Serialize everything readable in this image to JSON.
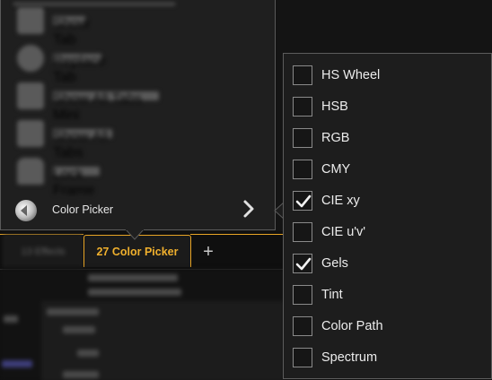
{
  "tabs": {
    "inactive_label": "13 Effects",
    "active_label": "27 Color Picker",
    "add_label": "+"
  },
  "toolbox": {
    "blurred_items": [
      "Show Tab",
      "Replace Tab",
      "Show All Tabs Mini",
      "Show All Tabs",
      "Lock Frame"
    ],
    "color_picker_label": "Color Picker"
  },
  "menu": {
    "items": [
      {
        "label": "HS Wheel",
        "checked": false
      },
      {
        "label": "HSB",
        "checked": false
      },
      {
        "label": "RGB",
        "checked": false
      },
      {
        "label": "CMY",
        "checked": false
      },
      {
        "label": "CIE xy",
        "checked": true
      },
      {
        "label": "CIE u'v'",
        "checked": false
      },
      {
        "label": "Gels",
        "checked": true
      },
      {
        "label": "Tint",
        "checked": false
      },
      {
        "label": "Color Path",
        "checked": false
      },
      {
        "label": "Spectrum",
        "checked": false
      }
    ]
  },
  "colors": {
    "accent": "#e8a425",
    "menu_bg": "#1d1d1d",
    "text": "#ececec"
  }
}
